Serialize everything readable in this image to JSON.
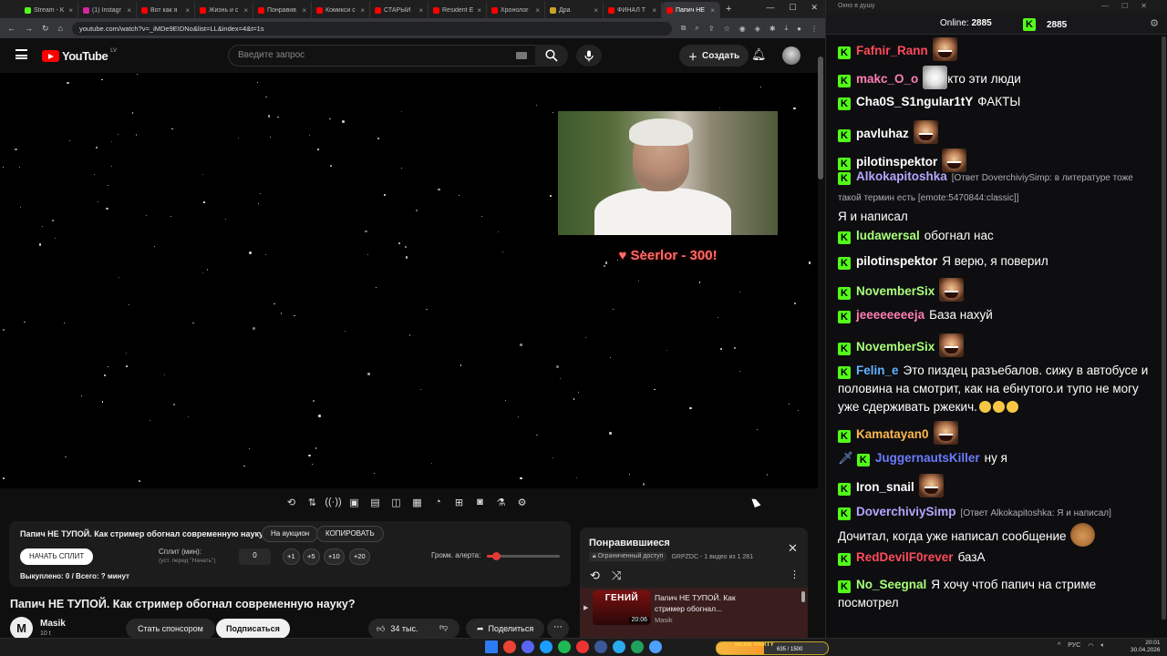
{
  "browser": {
    "tabs": [
      {
        "label": "Stream - K",
        "color": "#53fc18"
      },
      {
        "label": "(1) Instagr",
        "color": "#d6249f"
      },
      {
        "label": "Вот как я",
        "color": "#ff0000"
      },
      {
        "label": "Жизнь и с",
        "color": "#ff0000"
      },
      {
        "label": "Понравив",
        "color": "#ff0000"
      },
      {
        "label": "Комикси с",
        "color": "#ff0000"
      },
      {
        "label": "СТАРЫЙ",
        "color": "#ff0000"
      },
      {
        "label": "Resident E",
        "color": "#ff0000"
      },
      {
        "label": "Хронолог",
        "color": "#ff0000"
      },
      {
        "label": "Дра",
        "color": "#c9a227"
      },
      {
        "label": "ФИНАЛ Т",
        "color": "#ff0000"
      },
      {
        "label": "Папич НЕ",
        "color": "#ff0000",
        "active": true
      }
    ],
    "new_tab": "+",
    "url": "youtube.com/watch?v=_iMDe9EIDNo&list=LL&index=4&t=1s"
  },
  "youtube": {
    "logo_text": "YouTube",
    "country": "LV",
    "search_placeholder": "Введите запрос",
    "create_label": "Создать"
  },
  "video": {
    "donation_text": "♥ Seerlor - 300!"
  },
  "split_panel": {
    "title": "Папич НЕ ТУПОЙ. Как стример обогнал современную науку?",
    "auction_label": "На аукцион",
    "copy_label": "КОПИРОВАТЬ",
    "start_split_label": "НАЧАТЬ СПЛИТ",
    "split_label": "Сплит (мин):",
    "split_hint": "(уст. перед \"Начать\")",
    "split_value": "0",
    "steps": [
      "+1",
      "+5",
      "+10",
      "+20"
    ],
    "volume_label": "Громк. алерта:",
    "volume_level": 0.12,
    "stats": "Выкуплено: 0 / Всего: ? минут"
  },
  "watch": {
    "title": "Папич НЕ ТУПОЙ. Как стример обогнал современную науку?",
    "channel_initial": "M",
    "channel": "Masik",
    "subscribers": "10 t",
    "sponsor_label": "Стать спонсором",
    "subscribe_label": "Подписаться",
    "likes": "34 тыс.",
    "share_label": "Поделиться"
  },
  "playlist": {
    "title": "Понравившиеся",
    "access_badge": "Ограниченный доступ",
    "meta": "GRPZDC - 1 видео из 1 281",
    "item": {
      "thumb_text": "ГЕНИЙ",
      "duration": "20:06",
      "title": "Папич НЕ ТУПОЙ. Как стример обогнал...",
      "channel": "Masik"
    }
  },
  "chat": {
    "window_title": "Окно в душу",
    "online_label": "Online:",
    "online_count": "2885",
    "kick_count": "2885",
    "messages": [
      {
        "user": "Fafnir_Rann",
        "color": "#ff4b5c",
        "text": "",
        "emote": "face"
      },
      {
        "user": "makc_O_o",
        "color": "#ff7eb6",
        "text": "кто эти люди",
        "emote": "cat"
      },
      {
        "user": "Cha0S_S1ngular1tY",
        "color": "#ffffff",
        "text": "ФАКТЫ"
      },
      {
        "user": "pavluhaz",
        "color": "#ffffff",
        "text": "",
        "emote": "face"
      },
      {
        "user": "pilotinspektor",
        "color": "#ffffff",
        "text": "",
        "emote": "face"
      },
      {
        "user": "Alkokapitoshka",
        "color": "#b5a6ff",
        "reply": "[Ответ DoverchiviySimp: в литературе тоже такой термин есть [emote:5470844:classic]]",
        "text": "Я и написал"
      },
      {
        "user": "ludawersal",
        "color": "#a8ff7a",
        "text": "обогнал нас"
      },
      {
        "user": "pilotinspektor",
        "color": "#ffffff",
        "text": "Я верю, я поверил"
      },
      {
        "user": "NovemberSix",
        "color": "#a8ff7a",
        "text": "",
        "emote": "face"
      },
      {
        "user": "jeeeeeeeeja",
        "color": "#ff7eb6",
        "text": "База нахуй"
      },
      {
        "user": "NovemberSix",
        "color": "#a8ff7a",
        "text": "",
        "emote": "face"
      },
      {
        "user": "Felin_e",
        "color": "#5fb3ff",
        "text": "Это пиздец разъебалов. сижу в автобусе и половина на смотрит, как на ебнутого.и тупо не могу уже сдерживать ржекич."
      },
      {
        "user": "Kamatayan0",
        "color": "#ffb84d",
        "text": "",
        "emote": "face"
      },
      {
        "user": "JuggernautsKiller",
        "color": "#6b7bff",
        "text": "ну я"
      },
      {
        "user": "Iron_snail",
        "color": "#ffffff",
        "text": "",
        "emote": "face"
      },
      {
        "user": "DoverchiviySimp",
        "color": "#b5a6ff",
        "reply": "[Ответ Alkokapitoshka: Я и написал]",
        "text": "Дочитал, когда уже написал сообщение",
        "emote": "jerry"
      },
      {
        "user": "RedDevilF0rever",
        "color": "#ff4b5c",
        "text": "базА"
      },
      {
        "user": "No_Seegnal",
        "color": "#a8ff7a",
        "text": "Я хочу чтоб папич на стриме посмотрел"
      }
    ]
  },
  "taskbar": {
    "meme_label": "MEME PARTY",
    "meme_count": "635 / 1500",
    "meme_progress": 0.42,
    "lang": "РУС",
    "time": "20:01",
    "date": "30.04.2026"
  }
}
